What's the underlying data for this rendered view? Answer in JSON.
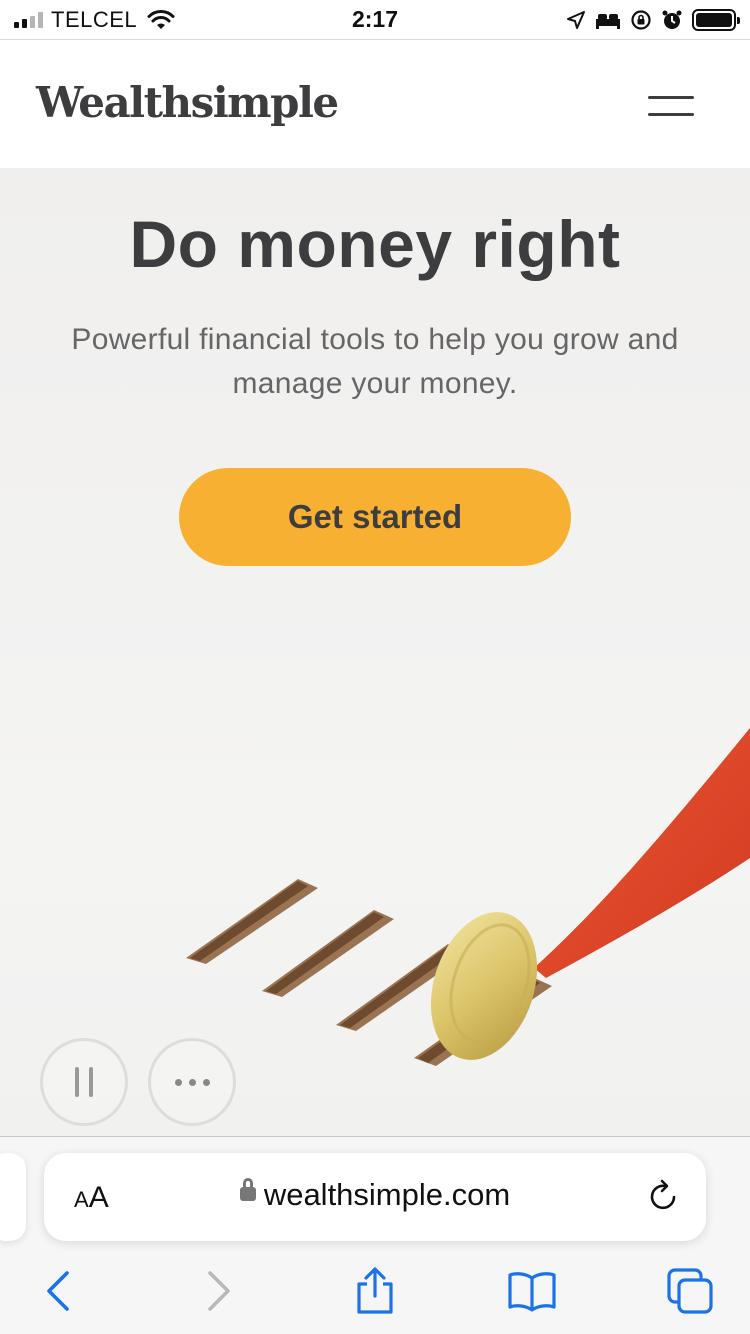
{
  "status_bar": {
    "carrier": "TELCEL",
    "time": "2:17",
    "signal_bars_active": 2,
    "signal_bars_total": 4
  },
  "header": {
    "logo_text": "Wealthsimple",
    "menu_icon": "hamburger-menu-icon"
  },
  "hero": {
    "title": "Do money right",
    "subtitle": "Powerful financial tools to help you grow and manage your money.",
    "cta_label": "Get started",
    "cta_color": "#f7b031",
    "video_controls": {
      "pause_icon": "pause-icon",
      "more_icon": "more-icon"
    }
  },
  "browser": {
    "text_size_label_small": "A",
    "text_size_label_big": "A",
    "url": "wealthsimple.com",
    "toolbar_icons": [
      "back-icon",
      "forward-icon",
      "share-icon",
      "bookmarks-icon",
      "tabs-icon"
    ],
    "accent_color": "#1a73e8"
  }
}
